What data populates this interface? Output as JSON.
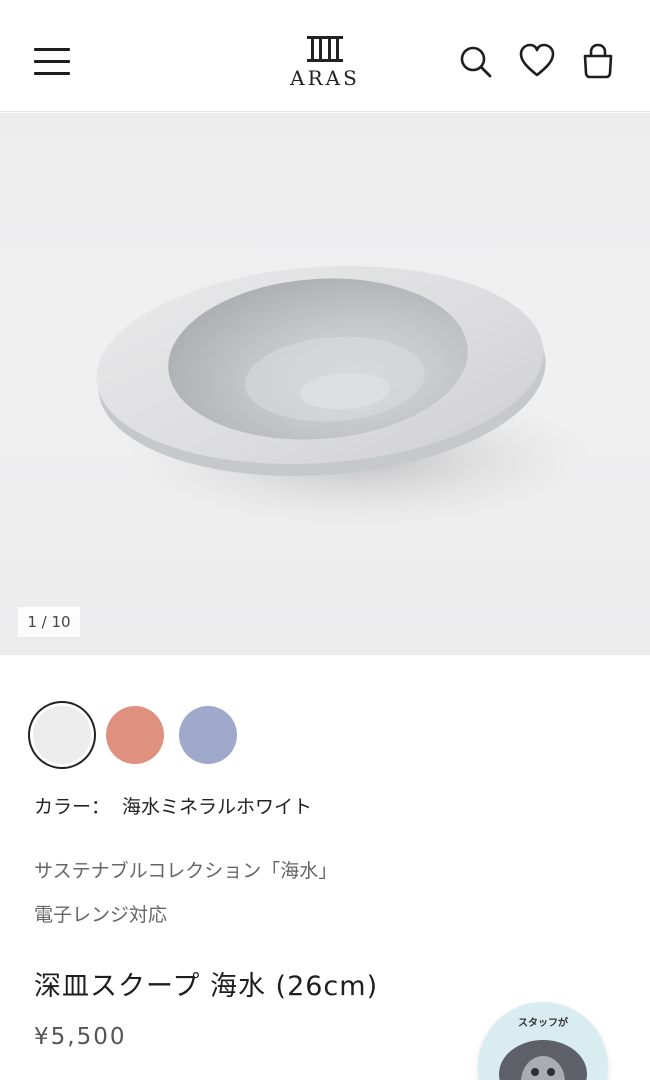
{
  "header": {
    "logo_text": "ARAS",
    "icons": {
      "menu": "hamburger-menu-icon",
      "search": "search-icon",
      "wishlist": "heart-icon",
      "cart": "shopping-bag-icon"
    }
  },
  "gallery": {
    "counter": "1 / 10",
    "current_index": 1,
    "total": 10
  },
  "colors": {
    "swatches": [
      {
        "name": "海水ミネラルホワイト",
        "hex": "#ececec",
        "selected": true
      },
      {
        "name": "coral",
        "hex": "#e0907e",
        "selected": false
      },
      {
        "name": "blue",
        "hex": "#9fa9ca",
        "selected": false
      }
    ],
    "label": "カラー：",
    "selected_name": "海水ミネラルホワイト"
  },
  "product": {
    "collection": "サステナブルコレクション「海水」",
    "feature": "電子レンジ対応",
    "title": "深皿スクープ 海水 (26cm)",
    "price": "¥5,500"
  },
  "staff_widget": {
    "label": "スタッフが"
  }
}
